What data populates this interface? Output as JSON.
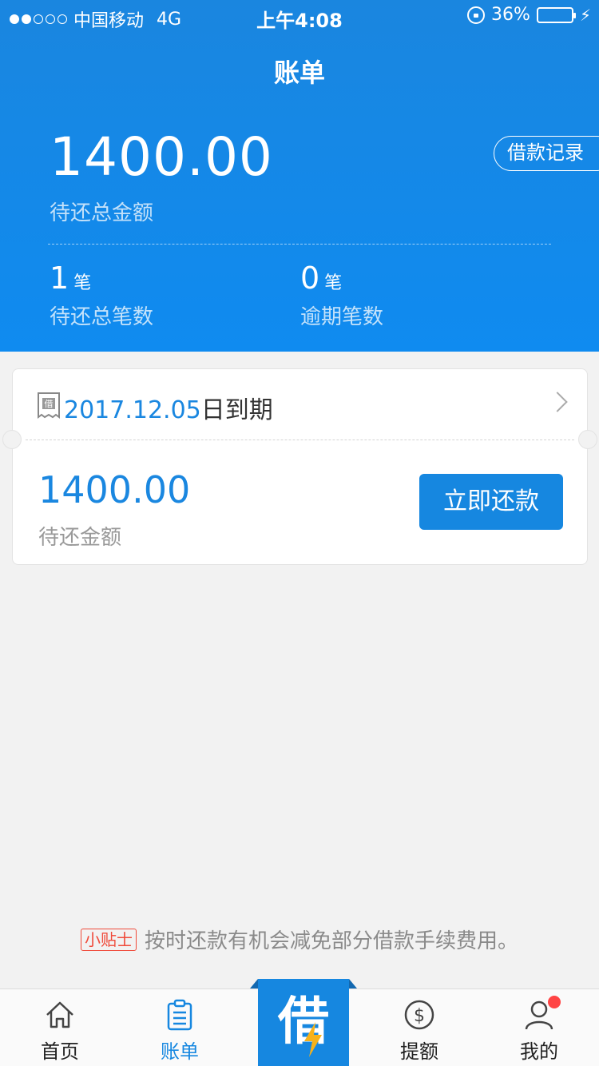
{
  "status_bar": {
    "carrier": "中国移动",
    "network": "4G",
    "time": "上午4:08",
    "battery_percent": "36%",
    "battery_level": 0.36,
    "battery_color": "#4cd964"
  },
  "nav": {
    "title": "账单"
  },
  "summary": {
    "total_amount": "1400.00",
    "total_label": "待还总金额",
    "record_button": "借款记录",
    "pending_count": "1",
    "pending_unit": "笔",
    "pending_label": "待还总笔数",
    "overdue_count": "0",
    "overdue_unit": "笔",
    "overdue_label": "逾期笔数"
  },
  "bill_card": {
    "icon_char": "借",
    "due_date": "2017.12.05",
    "due_suffix": "日到期",
    "amount": "1400.00",
    "amount_label": "待还金额",
    "repay_button": "立即还款"
  },
  "tip": {
    "badge": "小贴士",
    "text": "按时还款有机会减免部分借款手续费用。"
  },
  "tabbar": {
    "home": "首页",
    "bill": "账单",
    "borrow": "借",
    "quota": "提额",
    "mine": "我的"
  },
  "colors": {
    "primary": "#1687e0",
    "header_top": "#1a86df",
    "alert_red": "#f04a3a"
  }
}
